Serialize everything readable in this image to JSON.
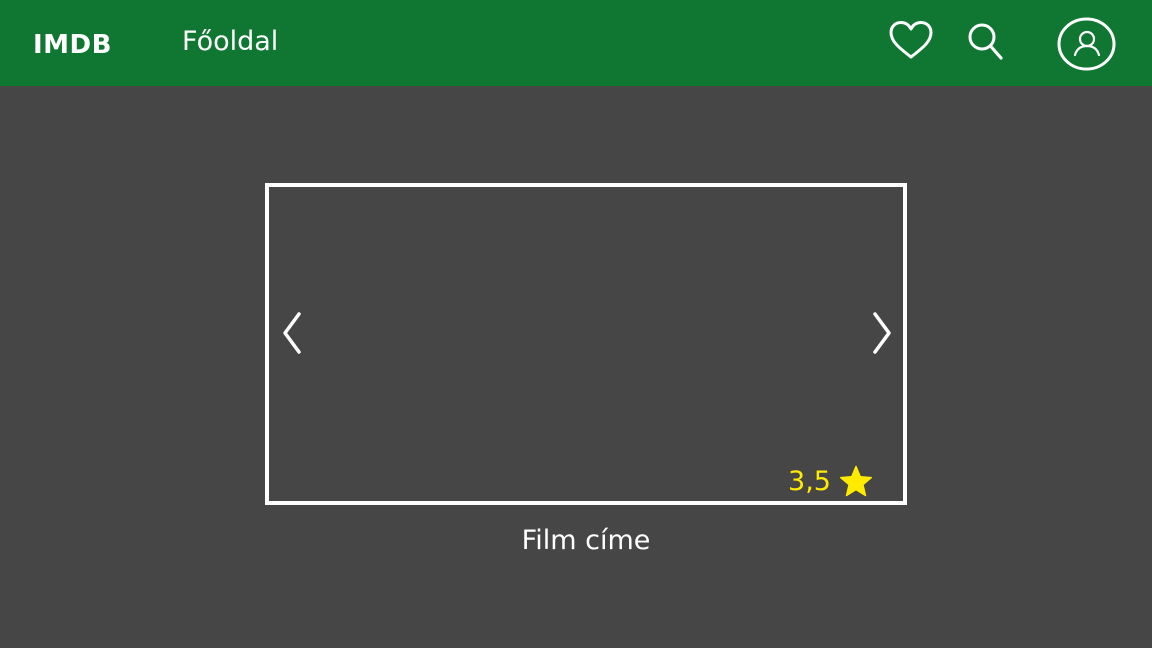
{
  "navbar": {
    "logo": "IMDB",
    "home_link": "Főoldal",
    "background": "#107733",
    "icons": [
      "heart-icon",
      "search-icon",
      "user-profile-icon"
    ]
  },
  "carousel": {
    "rating": "3,5",
    "rating_color": "#ffeb00",
    "film_title": "Film címe",
    "icons": [
      "chevron-left-icon",
      "chevron-right-icon",
      "star-icon"
    ]
  },
  "colors": {
    "page_background": "#464646",
    "border": "#ffffff"
  }
}
